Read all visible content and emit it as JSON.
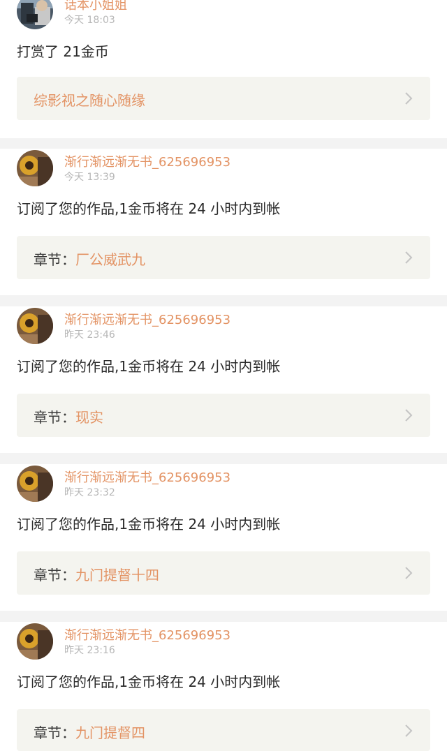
{
  "colors": {
    "accent": "#e39364",
    "page_bg": "#f3f3f3",
    "card_bg": "#ffffff",
    "link_bg": "#f4f4ef",
    "text": "#2b2b2b",
    "muted": "#b7b7b7",
    "chevron": "#c4c4c4"
  },
  "notifications": [
    {
      "user": "话本小姐姐",
      "time": "今天 18:03",
      "message": "打赏了 21金币",
      "link_prefix": "",
      "link_title": "综影视之随心随缘",
      "avatar": "photo-avatar-icon"
    },
    {
      "user": "渐行渐远渐无书_625696953",
      "time": "今天 13:39",
      "message": "订阅了您的作品,1金币将在 24 小时内到帐",
      "link_prefix": "章节：",
      "link_title": "厂公威武九",
      "avatar": "sunflower-avatar-icon"
    },
    {
      "user": "渐行渐远渐无书_625696953",
      "time": "昨天 23:46",
      "message": "订阅了您的作品,1金币将在 24 小时内到帐",
      "link_prefix": "章节：",
      "link_title": "现实",
      "avatar": "sunflower-avatar-icon"
    },
    {
      "user": "渐行渐远渐无书_625696953",
      "time": "昨天 23:32",
      "message": "订阅了您的作品,1金币将在 24 小时内到帐",
      "link_prefix": "章节：",
      "link_title": "九门提督十四",
      "avatar": "sunflower-avatar-icon"
    },
    {
      "user": "渐行渐远渐无书_625696953",
      "time": "昨天 23:16",
      "message": "订阅了您的作品,1金币将在 24 小时内到帐",
      "link_prefix": "章节：",
      "link_title": "九门提督四",
      "avatar": "sunflower-avatar-icon"
    }
  ]
}
